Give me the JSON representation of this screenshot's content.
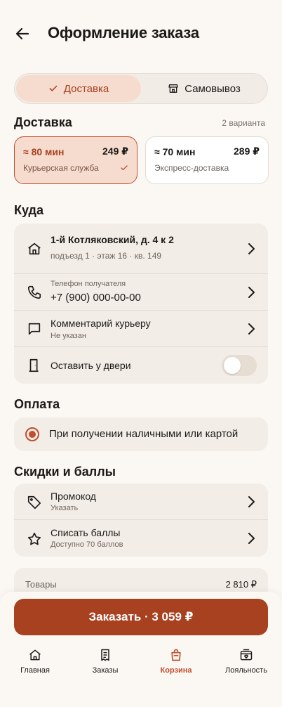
{
  "header": {
    "title": "Оформление заказа",
    "back_icon": "arrow-left-icon"
  },
  "mode": {
    "options": [
      {
        "label": "Доставка",
        "icon": "check-icon",
        "active": true
      },
      {
        "label": "Самовывоз",
        "icon": "store-icon",
        "active": false
      }
    ]
  },
  "delivery": {
    "title": "Доставка",
    "count_label": "2 варианта",
    "options": [
      {
        "time": "≈ 80 мин",
        "price": "249 ₽",
        "name": "Курьерская служба",
        "selected": true
      },
      {
        "time": "≈ 70 мин",
        "price": "289 ₽",
        "name": "Экспресс-доставка",
        "selected": false
      }
    ]
  },
  "where": {
    "title": "Куда",
    "address": {
      "main": "1-й Котляковский, д. 4 к 2",
      "sub": "подъезд 1 · этаж 16 · кв. 149",
      "icon": "home-icon"
    },
    "phone": {
      "label": "Телефон получателя",
      "value": "+7 (900) 000-00-00",
      "icon": "phone-icon"
    },
    "comment": {
      "main": "Комментарий курьеру",
      "sub": "Не указан",
      "icon": "chat-icon"
    },
    "door": {
      "label": "Оставить у двери",
      "icon": "door-icon",
      "enabled": false
    }
  },
  "payment": {
    "title": "Оплата",
    "selected_label": "При получении наличными или картой"
  },
  "discounts": {
    "title": "Скидки и баллы",
    "promo": {
      "main": "Промокод",
      "sub": "Указать",
      "icon": "tag-icon"
    },
    "points": {
      "main": "Списать баллы",
      "sub": "Доступно 70 баллов",
      "icon": "star-icon"
    }
  },
  "summary": {
    "goods_label": "Товары",
    "goods_value": "2 810 ₽"
  },
  "order_button": {
    "label": "Заказать · 3 059 ₽"
  },
  "tabbar": [
    {
      "label": "Главная",
      "icon": "home-icon",
      "active": false
    },
    {
      "label": "Заказы",
      "icon": "receipt-icon",
      "active": false
    },
    {
      "label": "Корзина",
      "icon": "bag-icon",
      "active": true
    },
    {
      "label": "Лояльность",
      "icon": "loyalty-icon",
      "active": false
    }
  ],
  "colors": {
    "accent": "#c24e2e",
    "accent_dark": "#a8411f",
    "accent_soft": "#f6dccf",
    "background": "#fbf8f4",
    "card": "#f2ede7"
  }
}
